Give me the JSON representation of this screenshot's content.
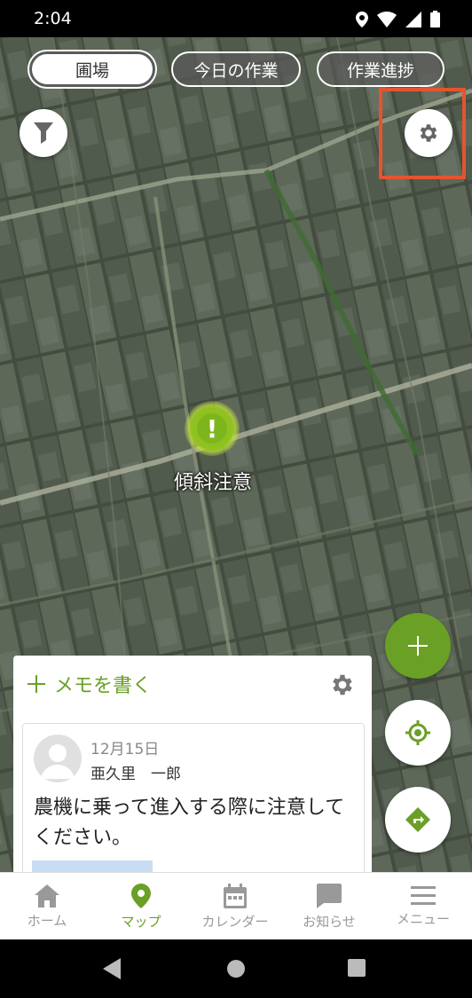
{
  "status_bar": {
    "time": "2:04"
  },
  "tabs": [
    {
      "label": "圃場",
      "active": true
    },
    {
      "label": "今日の作業",
      "active": false
    },
    {
      "label": "作業進捗",
      "active": false
    }
  ],
  "map": {
    "marker_label": "傾斜注意",
    "marker_symbol": "!"
  },
  "memo": {
    "write_label": "メモを書く",
    "entry": {
      "date": "12月15日",
      "author": "亜久里　一郎",
      "text": "農機に乗って進入する際に注意してください。"
    }
  },
  "bottom_nav": [
    {
      "label": "ホーム",
      "icon": "home-icon",
      "active": false
    },
    {
      "label": "マップ",
      "icon": "map-pin-icon",
      "active": true
    },
    {
      "label": "カレンダー",
      "icon": "calendar-icon",
      "active": false
    },
    {
      "label": "お知らせ",
      "icon": "message-icon",
      "active": false
    },
    {
      "label": "メニュー",
      "icon": "menu-icon",
      "active": false
    }
  ],
  "colors": {
    "accent": "#6aa025",
    "highlight": "#e4552f",
    "marker": "#8dc21f"
  }
}
